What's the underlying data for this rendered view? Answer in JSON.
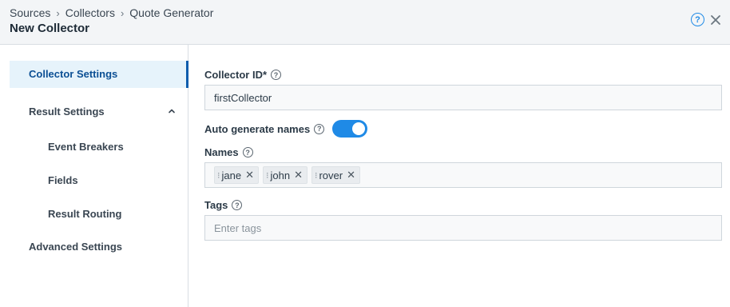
{
  "header": {
    "breadcrumb": [
      "Sources",
      "Collectors",
      "Quote Generator"
    ],
    "title": "New Collector",
    "help_icon": "help-circle-icon",
    "close_icon": "close-icon"
  },
  "sidebar": {
    "collector_settings": "Collector Settings",
    "result_settings": "Result Settings",
    "result_sub": [
      "Event Breakers",
      "Fields",
      "Result Routing"
    ],
    "advanced_settings": "Advanced Settings"
  },
  "form": {
    "collector_id": {
      "label": "Collector ID*",
      "value": "firstCollector"
    },
    "auto_generate": {
      "label": "Auto generate names",
      "enabled": true
    },
    "names": {
      "label": "Names",
      "chips": [
        "jane",
        "john",
        "rover"
      ]
    },
    "tags": {
      "label": "Tags",
      "placeholder": "Enter tags"
    }
  },
  "colors": {
    "accent": "#1f8ae6",
    "nav_active_bg": "#e6f3fb",
    "nav_active_text": "#0b4f94"
  }
}
